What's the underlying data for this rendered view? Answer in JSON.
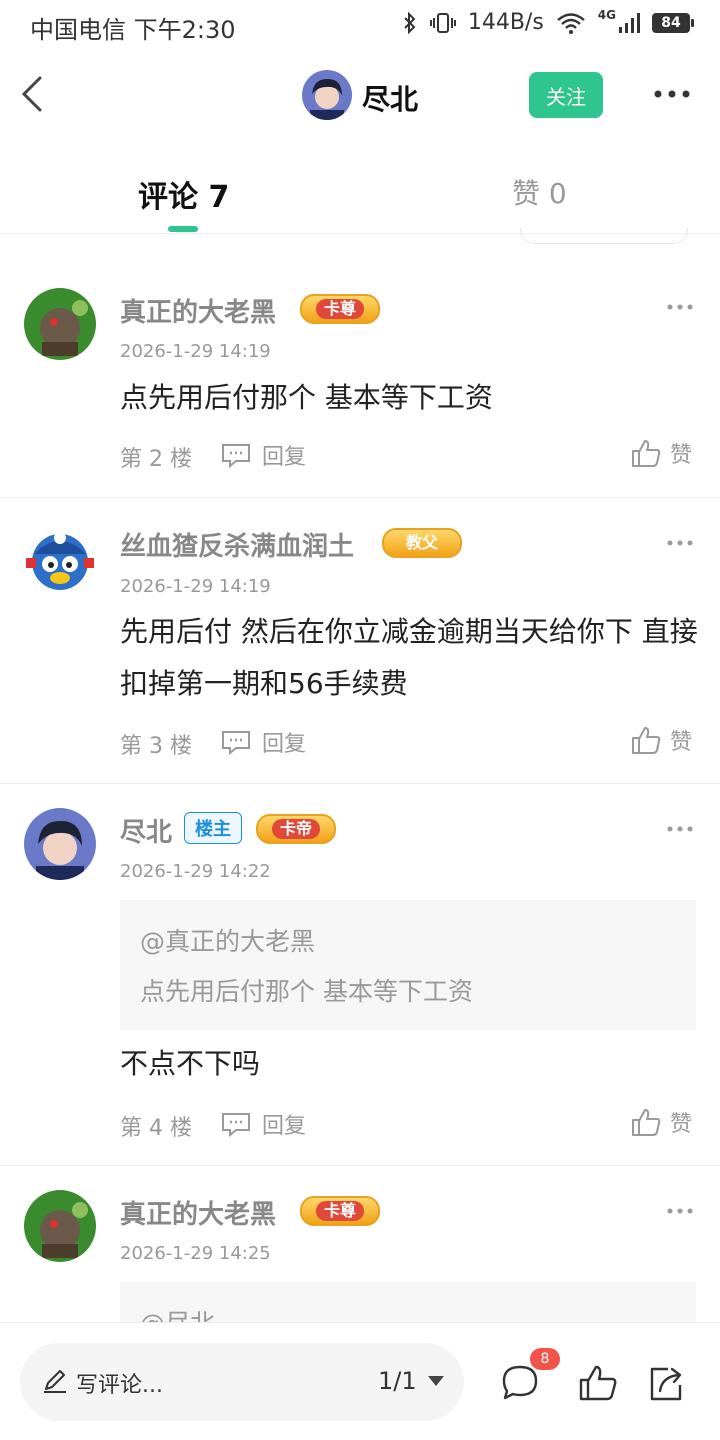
{
  "status_bar": {
    "carrier": "中国电信 下午2:30",
    "speed": "144B/s",
    "network": "4G",
    "battery": "84"
  },
  "header": {
    "name": "尽北",
    "follow_label": "关注"
  },
  "tabs": {
    "comments": "评论 7",
    "likes": "赞 0",
    "accent": "#2fc58e"
  },
  "comments": [
    {
      "user": "真正的大老黑",
      "badge": "卡尊",
      "time": "2026-1-29 14:19",
      "text": "点先用后付那个  基本等下工资",
      "floor": "第 2 楼",
      "reply": "回复",
      "like": "赞"
    },
    {
      "user": "丝血猹反杀满血润土",
      "badge": "教父",
      "time": "2026-1-29 14:19",
      "text": "先用后付 然后在你立减金逾期当天给你下 直接扣掉第一期和56手续费",
      "floor": "第 3 楼",
      "reply": "回复",
      "like": "赞"
    },
    {
      "user": "尽北",
      "owner_badge": "楼主",
      "badge": "卡帝",
      "time": "2026-1-29 14:22",
      "quote_user": "@真正的大老黑",
      "quote_text": "点先用后付那个  基本等下工资",
      "text": "不点不下吗",
      "floor": "第 4 楼",
      "reply": "回复",
      "like": "赞"
    },
    {
      "user": "真正的大老黑",
      "badge": "卡尊",
      "time": "2026-1-29 14:25",
      "quote_user": "@尽北"
    }
  ],
  "bottom_bar": {
    "placeholder": "写评论...",
    "page": "1/1",
    "comment_count": "8"
  }
}
